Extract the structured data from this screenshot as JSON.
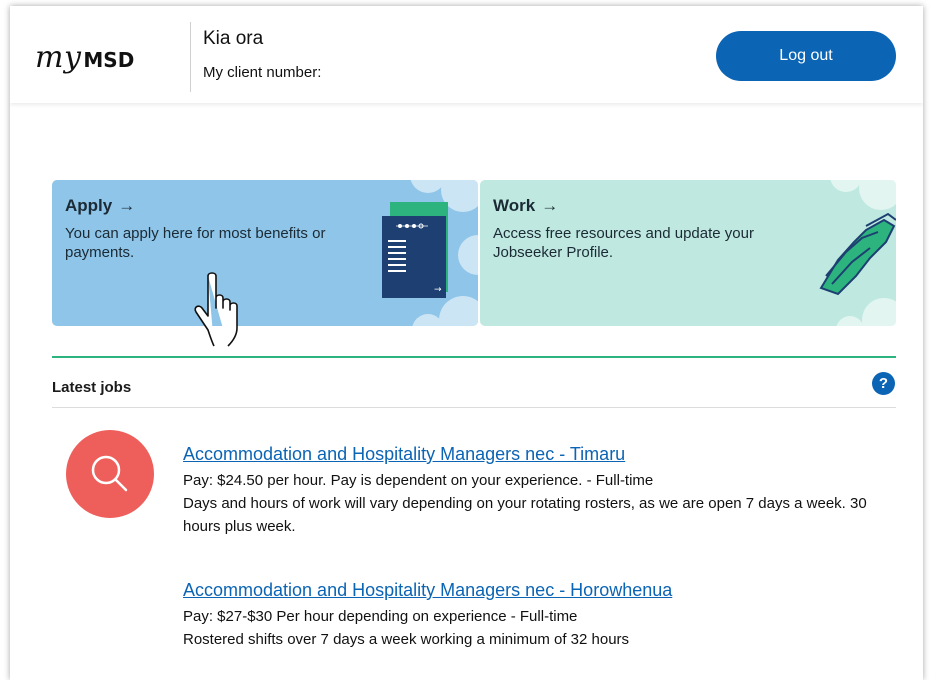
{
  "header": {
    "logo": {
      "prefix": "my",
      "brand": "MSD"
    },
    "greeting": "Kia ora",
    "client_number_label": "My client number:",
    "logout_label": "Log out"
  },
  "cards": [
    {
      "title": "Apply",
      "arrow": "→",
      "description": "You can apply here for most benefits or payments.",
      "icon": "document-form-icon"
    },
    {
      "title": "Work",
      "arrow": "→",
      "description": "Access free resources and update your Jobseeker Profile.",
      "icon": "handshake-icon"
    }
  ],
  "jobs": {
    "heading": "Latest jobs",
    "help_label": "?",
    "icon": "search-icon",
    "items": [
      {
        "title": "Accommodation and Hospitality Managers nec - Timaru",
        "pay": "Pay: $24.50 per hour. Pay is dependent on your experience. - Full-time",
        "description": "Days and hours of work will vary depending on your rotating rosters, as we are open 7 days a week. 30 hours plus week."
      },
      {
        "title": "Accommodation and Hospitality Managers nec - Horowhenua",
        "pay": "Pay: $27-$30 Per hour depending on experience - Full-time",
        "description": "Rostered shifts over 7 days a week working a minimum of 32 hours"
      }
    ]
  },
  "colors": {
    "primary": "#0b64b4",
    "apply_card": "#8ec5e8",
    "work_card": "#bfe9e0",
    "accent_line": "#2db37e",
    "search_circle": "#ee5f5b"
  }
}
